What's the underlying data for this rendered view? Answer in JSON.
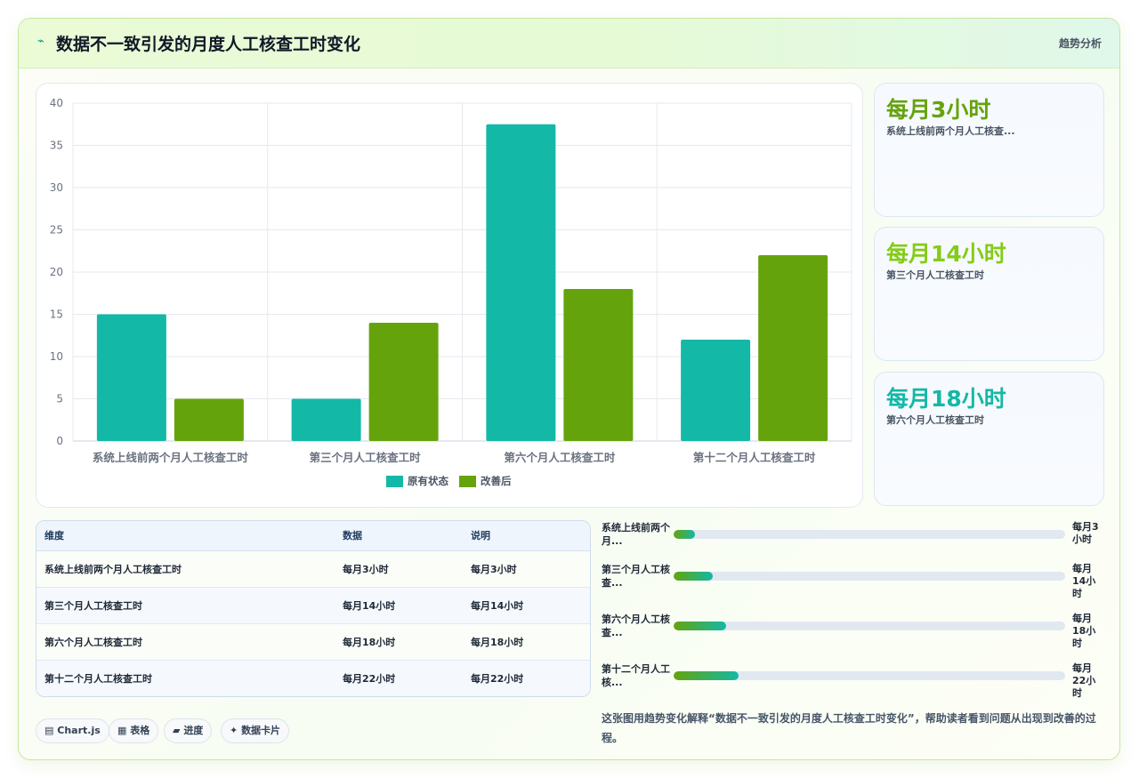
{
  "header": {
    "icon": "trend-icon",
    "title": "数据不一致引发的月度人工核查工时变化",
    "badge": "趋势分析"
  },
  "chart_data": {
    "type": "bar",
    "categories": [
      "系统上线前两个月人工核查工时",
      "第三个月人工核查工时",
      "第六个月人工核查工时",
      "第十二个月人工核查工时"
    ],
    "series": [
      {
        "name": "原有状态",
        "color": "#14b8a6",
        "values": [
          15,
          5,
          37.5,
          12
        ]
      },
      {
        "name": "改善后",
        "color": "#65a30d",
        "values": [
          5,
          14,
          18,
          22
        ]
      }
    ],
    "ylim": [
      0,
      40
    ],
    "yticks": [
      0,
      5,
      10,
      15,
      20,
      25,
      30,
      35,
      40
    ],
    "grid": true,
    "legend": "bottom"
  },
  "stats": [
    {
      "value": "每月3小时",
      "label": "系统上线前两个月人工核查...",
      "color": "#65a30d"
    },
    {
      "value": "每月14小时",
      "label": "第三个月人工核查工时",
      "color": "#84cc16"
    },
    {
      "value": "每月18小时",
      "label": "第六个月人工核查工时",
      "color": "#14b8a6"
    }
  ],
  "table": {
    "headers": [
      "维度",
      "数据",
      "说明"
    ],
    "rows": [
      [
        "系统上线前两个月人工核查工时",
        "每月3小时",
        "每月3小时"
      ],
      [
        "第三个月人工核查工时",
        "每月14小时",
        "每月14小时"
      ],
      [
        "第六个月人工核查工时",
        "每月18小时",
        "每月18小时"
      ],
      [
        "第十二个月人工核查工时",
        "每月22小时",
        "每月22小时"
      ]
    ]
  },
  "progress": [
    {
      "label": "系统上线前两个月...",
      "value": "每月3小时",
      "fraction": 0.055
    },
    {
      "label": "第三个月人工核查...",
      "value": "每月14小时",
      "fraction": 0.1
    },
    {
      "label": "第六个月人工核查...",
      "value": "每月18小时",
      "fraction": 0.135
    },
    {
      "label": "第十二个月人工核...",
      "value": "每月22小时",
      "fraction": 0.165
    }
  ],
  "chips": [
    {
      "icon": "chart-icon",
      "glyph": "▤",
      "label": "Chart.js"
    },
    {
      "icon": "table-icon",
      "glyph": "▦",
      "label": "表格"
    },
    {
      "icon": "progress-icon",
      "glyph": "▰",
      "label": "进度"
    },
    {
      "icon": "card-icon",
      "glyph": "✦",
      "label": "数据卡片"
    }
  ],
  "caption": "这张图用趋势变化解释“数据不一致引发的月度人工核查工时变化”，帮助读者看到问题从出现到改善的过程。"
}
